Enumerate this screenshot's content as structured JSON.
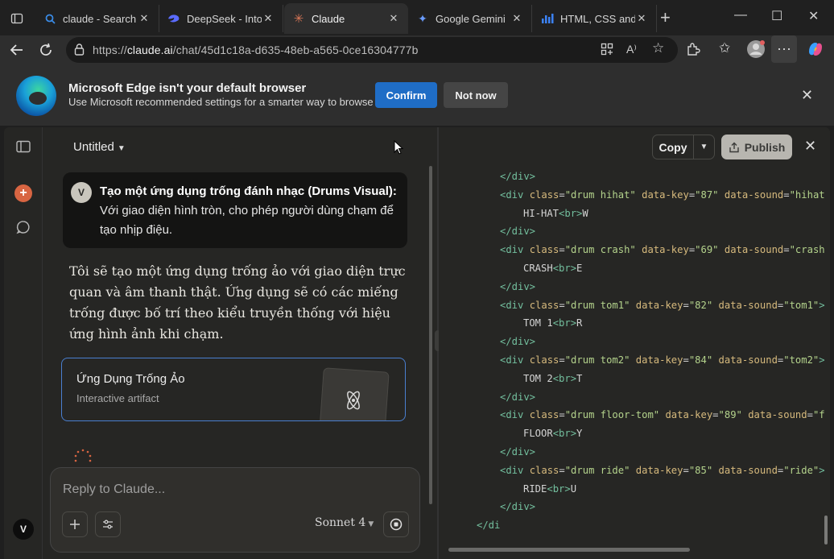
{
  "browser": {
    "tabs": [
      {
        "title": "claude - Search",
        "icon": "search-icon",
        "icon_color": "#3a8be6"
      },
      {
        "title": "DeepSeek - Into t",
        "icon": "deepseek-icon",
        "icon_color": "#5a6bff"
      },
      {
        "title": "Claude",
        "icon": "claude-icon",
        "icon_color": "#d97757",
        "active": true
      },
      {
        "title": "Google Gemini",
        "icon": "gemini-icon",
        "icon_color": "#6a9cff"
      },
      {
        "title": "HTML, CSS and Ja",
        "icon": "chart-icon",
        "icon_color": "#3b82f6"
      }
    ],
    "url_prefix": "https://",
    "url_host": "claude.ai",
    "url_path": "/chat/45d1c18a-d635-48eb-a565-0ce16304777b"
  },
  "infobar": {
    "title": "Microsoft Edge isn't your default browser",
    "subtitle": "Use Microsoft recommended settings for a smarter way to browse",
    "confirm_label": "Confirm",
    "notnow_label": "Not now"
  },
  "chat": {
    "title": "Untitled",
    "user_avatar": "V",
    "user_message_bold": "Tạo một ứng dụng trống đánh nhạc (Drums Visual):",
    "user_message_rest": " Với giao diện hình tròn, cho phép người dùng chạm để tạo nhịp điệu.",
    "assistant_message": "Tôi sẽ tạo một ứng dụng trống ảo với giao diện trực quan và âm thanh thật. Ứng dụng sẽ có các miếng trống được bố trí theo kiểu truyền thống với hiệu ứng hình ảnh khi chạm.",
    "artifact_title": "Ứng Dụng Trống Ảo",
    "artifact_subtitle": "Interactive artifact",
    "composer_placeholder": "Reply to Claude...",
    "model": "Sonnet 4",
    "account_avatar": "V"
  },
  "artifact_panel": {
    "copy_label": "Copy",
    "publish_label": "Publish",
    "code_lines": [
      {
        "indent": 1,
        "parts": [
          [
            "tag",
            "</div>"
          ]
        ]
      },
      {
        "indent": 1,
        "parts": [
          [
            "tag",
            "<div "
          ],
          [
            "attr",
            "class"
          ],
          [
            "punc",
            "="
          ],
          [
            "str",
            "\"drum hihat\""
          ],
          [
            "punc",
            " "
          ],
          [
            "attr",
            "data-key"
          ],
          [
            "punc",
            "="
          ],
          [
            "str",
            "\"87\""
          ],
          [
            "punc",
            " "
          ],
          [
            "attr",
            "data-sound"
          ],
          [
            "punc",
            "="
          ],
          [
            "str",
            "\"hihat\""
          ],
          [
            "tag",
            ">"
          ]
        ]
      },
      {
        "indent": 2,
        "parts": [
          [
            "txt",
            "HI-HAT"
          ],
          [
            "tag",
            "<br>"
          ],
          [
            "txt",
            "W"
          ]
        ]
      },
      {
        "indent": 1,
        "parts": [
          [
            "tag",
            "</div>"
          ]
        ]
      },
      {
        "indent": 1,
        "parts": [
          [
            "tag",
            "<div "
          ],
          [
            "attr",
            "class"
          ],
          [
            "punc",
            "="
          ],
          [
            "str",
            "\"drum crash\""
          ],
          [
            "punc",
            " "
          ],
          [
            "attr",
            "data-key"
          ],
          [
            "punc",
            "="
          ],
          [
            "str",
            "\"69\""
          ],
          [
            "punc",
            " "
          ],
          [
            "attr",
            "data-sound"
          ],
          [
            "punc",
            "="
          ],
          [
            "str",
            "\"crash\""
          ],
          [
            "tag",
            ">"
          ]
        ]
      },
      {
        "indent": 2,
        "parts": [
          [
            "txt",
            "CRASH"
          ],
          [
            "tag",
            "<br>"
          ],
          [
            "txt",
            "E"
          ]
        ]
      },
      {
        "indent": 1,
        "parts": [
          [
            "tag",
            "</div>"
          ]
        ]
      },
      {
        "indent": 1,
        "parts": [
          [
            "tag",
            "<div "
          ],
          [
            "attr",
            "class"
          ],
          [
            "punc",
            "="
          ],
          [
            "str",
            "\"drum tom1\""
          ],
          [
            "punc",
            " "
          ],
          [
            "attr",
            "data-key"
          ],
          [
            "punc",
            "="
          ],
          [
            "str",
            "\"82\""
          ],
          [
            "punc",
            " "
          ],
          [
            "attr",
            "data-sound"
          ],
          [
            "punc",
            "="
          ],
          [
            "str",
            "\"tom1\""
          ],
          [
            "tag",
            ">"
          ]
        ]
      },
      {
        "indent": 2,
        "parts": [
          [
            "txt",
            "TOM 1"
          ],
          [
            "tag",
            "<br>"
          ],
          [
            "txt",
            "R"
          ]
        ]
      },
      {
        "indent": 1,
        "parts": [
          [
            "tag",
            "</div>"
          ]
        ]
      },
      {
        "indent": 1,
        "parts": [
          [
            "tag",
            "<div "
          ],
          [
            "attr",
            "class"
          ],
          [
            "punc",
            "="
          ],
          [
            "str",
            "\"drum tom2\""
          ],
          [
            "punc",
            " "
          ],
          [
            "attr",
            "data-key"
          ],
          [
            "punc",
            "="
          ],
          [
            "str",
            "\"84\""
          ],
          [
            "punc",
            " "
          ],
          [
            "attr",
            "data-sound"
          ],
          [
            "punc",
            "="
          ],
          [
            "str",
            "\"tom2\""
          ],
          [
            "tag",
            ">"
          ]
        ]
      },
      {
        "indent": 2,
        "parts": [
          [
            "txt",
            "TOM 2"
          ],
          [
            "tag",
            "<br>"
          ],
          [
            "txt",
            "T"
          ]
        ]
      },
      {
        "indent": 1,
        "parts": [
          [
            "tag",
            "</div>"
          ]
        ]
      },
      {
        "indent": 1,
        "parts": [
          [
            "tag",
            "<div "
          ],
          [
            "attr",
            "class"
          ],
          [
            "punc",
            "="
          ],
          [
            "str",
            "\"drum floor-tom\""
          ],
          [
            "punc",
            " "
          ],
          [
            "attr",
            "data-key"
          ],
          [
            "punc",
            "="
          ],
          [
            "str",
            "\"89\""
          ],
          [
            "punc",
            " "
          ],
          [
            "attr",
            "data-sound"
          ],
          [
            "punc",
            "="
          ],
          [
            "str",
            "\"floor-tom\""
          ],
          [
            "tag",
            ">"
          ]
        ]
      },
      {
        "indent": 2,
        "parts": [
          [
            "txt",
            "FLOOR"
          ],
          [
            "tag",
            "<br>"
          ],
          [
            "txt",
            "Y"
          ]
        ]
      },
      {
        "indent": 1,
        "parts": [
          [
            "tag",
            "</div>"
          ]
        ]
      },
      {
        "indent": 1,
        "parts": [
          [
            "tag",
            "<div "
          ],
          [
            "attr",
            "class"
          ],
          [
            "punc",
            "="
          ],
          [
            "str",
            "\"drum ride\""
          ],
          [
            "punc",
            " "
          ],
          [
            "attr",
            "data-key"
          ],
          [
            "punc",
            "="
          ],
          [
            "str",
            "\"85\""
          ],
          [
            "punc",
            " "
          ],
          [
            "attr",
            "data-sound"
          ],
          [
            "punc",
            "="
          ],
          [
            "str",
            "\"ride\""
          ],
          [
            "tag",
            ">"
          ]
        ]
      },
      {
        "indent": 2,
        "parts": [
          [
            "txt",
            "RIDE"
          ],
          [
            "tag",
            "<br>"
          ],
          [
            "txt",
            "U"
          ]
        ]
      },
      {
        "indent": 1,
        "parts": [
          [
            "tag",
            "</div>"
          ]
        ]
      },
      {
        "indent": 0,
        "parts": [
          [
            "tag",
            "</di"
          ]
        ]
      }
    ]
  },
  "colors": {
    "accent_blue": "#1f6dc6",
    "claude_orange": "#d86542",
    "artifact_border": "#4a7fd0"
  }
}
